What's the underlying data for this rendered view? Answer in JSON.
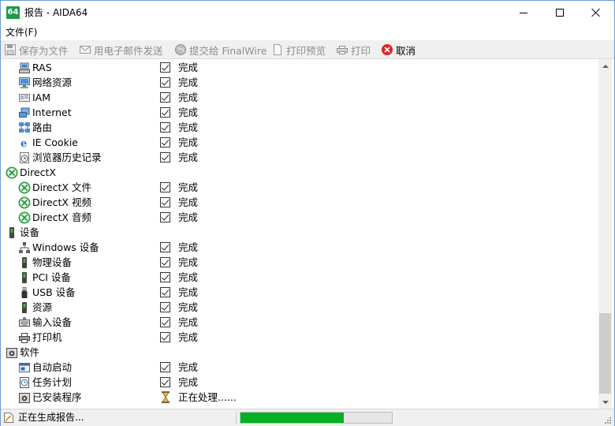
{
  "window": {
    "title": "报告 - AIDA64",
    "app_icon_text": "64"
  },
  "menu": {
    "file": "文件(F)"
  },
  "toolbar": {
    "save": "保存为文件",
    "email": "用电子邮件发送",
    "submit": "提交给 FinalWire",
    "preview": "打印预览",
    "print": "打印",
    "cancel": "取消"
  },
  "rows": [
    {
      "label": "RAS",
      "status": "完成",
      "icon": "ras-icon"
    },
    {
      "label": "网络资源",
      "status": "完成",
      "icon": "network-resources-icon"
    },
    {
      "label": "IAM",
      "status": "完成",
      "icon": "iam-icon"
    },
    {
      "label": "Internet",
      "status": "完成",
      "icon": "internet-icon"
    },
    {
      "label": "路由",
      "status": "完成",
      "icon": "routes-icon"
    },
    {
      "label": "IE Cookie",
      "status": "完成",
      "icon": "ie-icon"
    },
    {
      "label": "浏览器历史记录",
      "status": "完成",
      "icon": "browser-history-icon"
    },
    {
      "label": "DirectX",
      "status": "",
      "icon": "xbox-icon"
    },
    {
      "label": "DirectX 文件",
      "status": "完成",
      "icon": "xbox-icon"
    },
    {
      "label": "DirectX 视频",
      "status": "完成",
      "icon": "xbox-icon"
    },
    {
      "label": "DirectX 音频",
      "status": "完成",
      "icon": "xbox-icon"
    },
    {
      "label": "设备",
      "status": "",
      "icon": "device-icon"
    },
    {
      "label": "Windows 设备",
      "status": "完成",
      "icon": "windows-devices-icon"
    },
    {
      "label": "物理设备",
      "status": "完成",
      "icon": "device-icon"
    },
    {
      "label": "PCI 设备",
      "status": "完成",
      "icon": "device-icon"
    },
    {
      "label": "USB 设备",
      "status": "完成",
      "icon": "usb-icon"
    },
    {
      "label": "资源",
      "status": "完成",
      "icon": "device-icon"
    },
    {
      "label": "输入设备",
      "status": "完成",
      "icon": "keyboard-icon"
    },
    {
      "label": "打印机",
      "status": "完成",
      "icon": "printer-icon"
    },
    {
      "label": "软件",
      "status": "",
      "icon": "software-icon"
    },
    {
      "label": "自动启动",
      "status": "完成",
      "icon": "autostart-icon"
    },
    {
      "label": "任务计划",
      "status": "完成",
      "icon": "scheduled-tasks-icon"
    },
    {
      "label": "已安装程序",
      "status": "正在处理......",
      "icon": "software-icon"
    }
  ],
  "statusbar": {
    "text": "正在生成报告...",
    "progress": 0.68
  },
  "colors": {
    "progress": "#06b025",
    "xbox": "#2f9e44",
    "cancel": "#e02424"
  }
}
